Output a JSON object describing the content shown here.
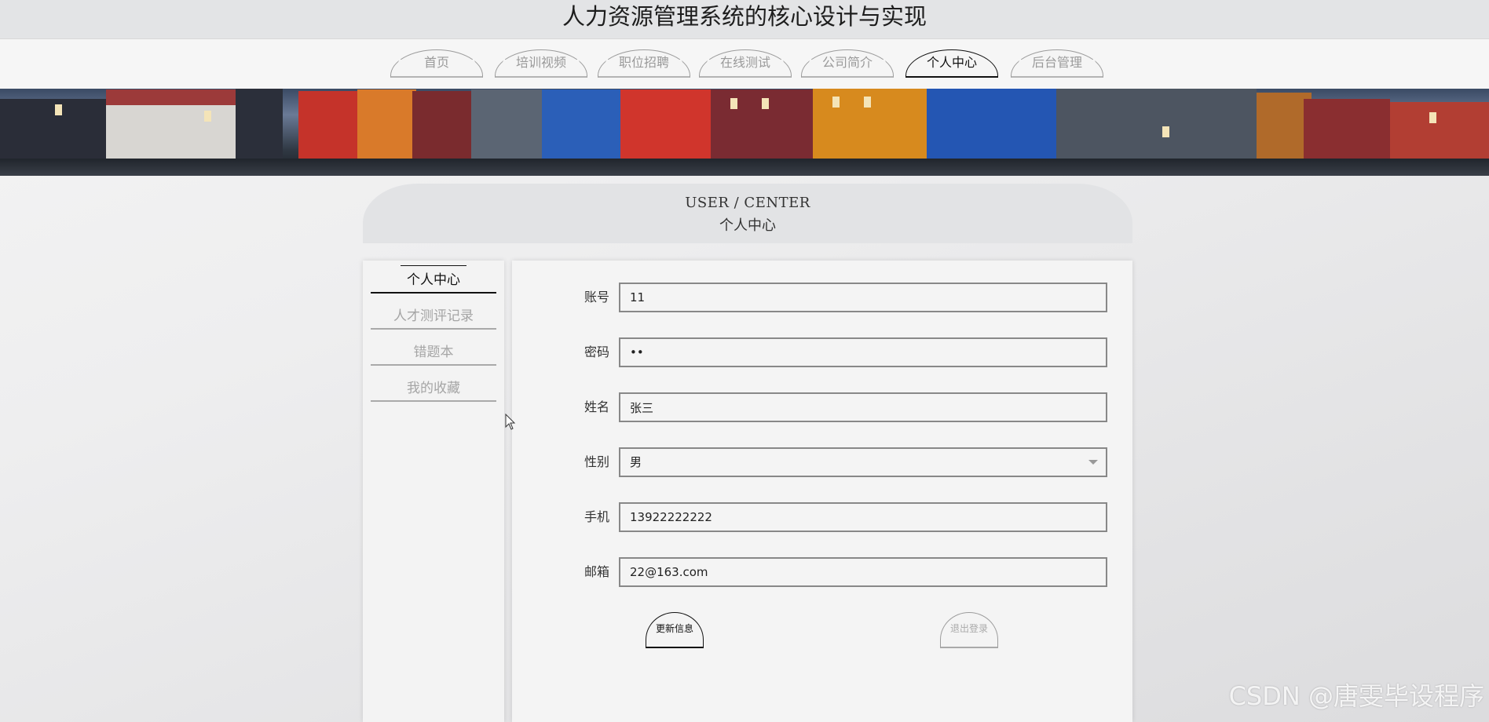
{
  "site": {
    "title": "人力资源管理系统的核心设计与实现"
  },
  "nav": {
    "items": [
      {
        "label": "首页"
      },
      {
        "label": "培训视频"
      },
      {
        "label": "职位招聘"
      },
      {
        "label": "在线测试"
      },
      {
        "label": "公司简介"
      },
      {
        "label": "个人中心"
      },
      {
        "label": "后台管理"
      }
    ],
    "active": "个人中心"
  },
  "section": {
    "title_en": "USER / CENTER",
    "title_cn": "个人中心"
  },
  "sidebar": {
    "items": [
      {
        "label": "个人中心"
      },
      {
        "label": "人才测评记录"
      },
      {
        "label": "错题本"
      },
      {
        "label": "我的收藏"
      }
    ],
    "active": "个人中心"
  },
  "form": {
    "account": {
      "label": "账号",
      "value": "11"
    },
    "password": {
      "label": "密码",
      "value": "11"
    },
    "name": {
      "label": "姓名",
      "value": "张三"
    },
    "gender": {
      "label": "性别",
      "value": "男"
    },
    "phone": {
      "label": "手机",
      "value": "13922222222"
    },
    "email": {
      "label": "邮箱",
      "value": "22@163.com"
    },
    "update_button": "更新信息",
    "logout_button": "退出登录"
  },
  "watermark": "CSDN @唐雯毕设程序",
  "colors": {
    "active": "#111111",
    "inactive": "#9a9a9a",
    "header_bg": "#e3e4e6"
  }
}
